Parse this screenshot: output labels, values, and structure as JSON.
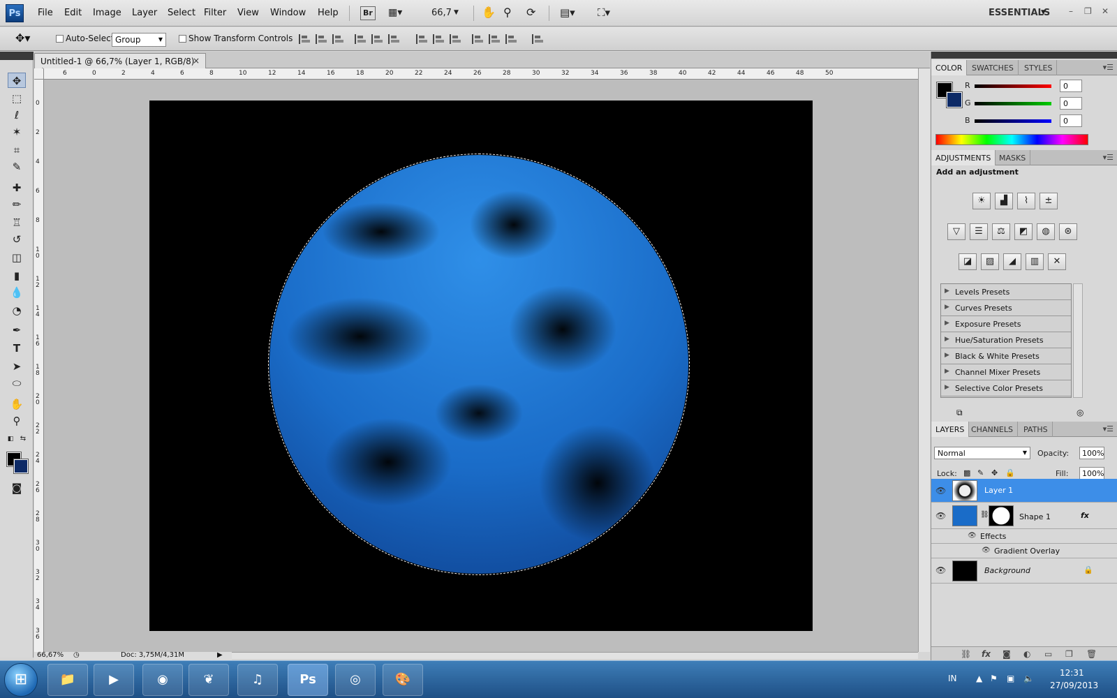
{
  "app": {
    "logo": "Ps"
  },
  "menu": [
    "File",
    "Edit",
    "Image",
    "Layer",
    "Select",
    "Filter",
    "View",
    "Window",
    "Help"
  ],
  "menubar": {
    "bridge_label": "Br",
    "zoom_value": "66,7",
    "workspace": "ESSENTIALS"
  },
  "options": {
    "auto_select_label": "Auto-Select:",
    "auto_select_value": "Group",
    "show_transform_label": "Show Transform Controls"
  },
  "document": {
    "tab_title": "Untitled-1 @ 66,7% (Layer 1, RGB/8) *",
    "close": "×"
  },
  "rulers": {
    "top": [
      "6",
      "0",
      "2",
      "4",
      "6",
      "8",
      "10",
      "12",
      "14",
      "16",
      "18",
      "20",
      "22",
      "24",
      "26",
      "28",
      "30",
      "32",
      "34",
      "36",
      "38",
      "40",
      "42",
      "44",
      "46",
      "48",
      "50"
    ],
    "left": [
      "0",
      "2",
      "4",
      "6",
      "8",
      "10",
      "12",
      "14",
      "16",
      "18",
      "20",
      "22",
      "24",
      "26",
      "28",
      "30",
      "32",
      "34",
      "36"
    ]
  },
  "status": {
    "zoom": "66,67%",
    "doc_info": "Doc: 3,75M/4,31M"
  },
  "color_panel": {
    "tabs": [
      "COLOR",
      "SWATCHES",
      "STYLES"
    ],
    "channels": [
      {
        "label": "R",
        "value": "0"
      },
      {
        "label": "G",
        "value": "0"
      },
      {
        "label": "B",
        "value": "0"
      }
    ],
    "fg": "#000000",
    "bg": "#0d2a66"
  },
  "adjustments_panel": {
    "tabs": [
      "ADJUSTMENTS",
      "MASKS"
    ],
    "title": "Add an adjustment",
    "presets": [
      "Levels Presets",
      "Curves Presets",
      "Exposure Presets",
      "Hue/Saturation Presets",
      "Black & White Presets",
      "Channel Mixer Presets",
      "Selective Color Presets"
    ]
  },
  "layers_panel": {
    "tabs": [
      "LAYERS",
      "CHANNELS",
      "PATHS"
    ],
    "blend_mode": "Normal",
    "opacity_label": "Opacity:",
    "opacity": "100%",
    "lock_label": "Lock:",
    "fill_label": "Fill:",
    "fill": "100%",
    "layers": [
      {
        "name": "Layer 1",
        "selected": true
      },
      {
        "name": "Shape 1",
        "fx": "fx"
      },
      {
        "name": "Effects"
      },
      {
        "name": "Gradient Overlay"
      },
      {
        "name": "Background"
      }
    ]
  },
  "taskbar": {
    "lang": "IN",
    "time": "12:31",
    "date": "27/09/2013",
    "apps": [
      "file-explorer",
      "media-player",
      "firefox",
      "app-green",
      "speakers",
      "photoshop",
      "chrome",
      "paint-app"
    ],
    "photoshop_label": "Ps"
  }
}
